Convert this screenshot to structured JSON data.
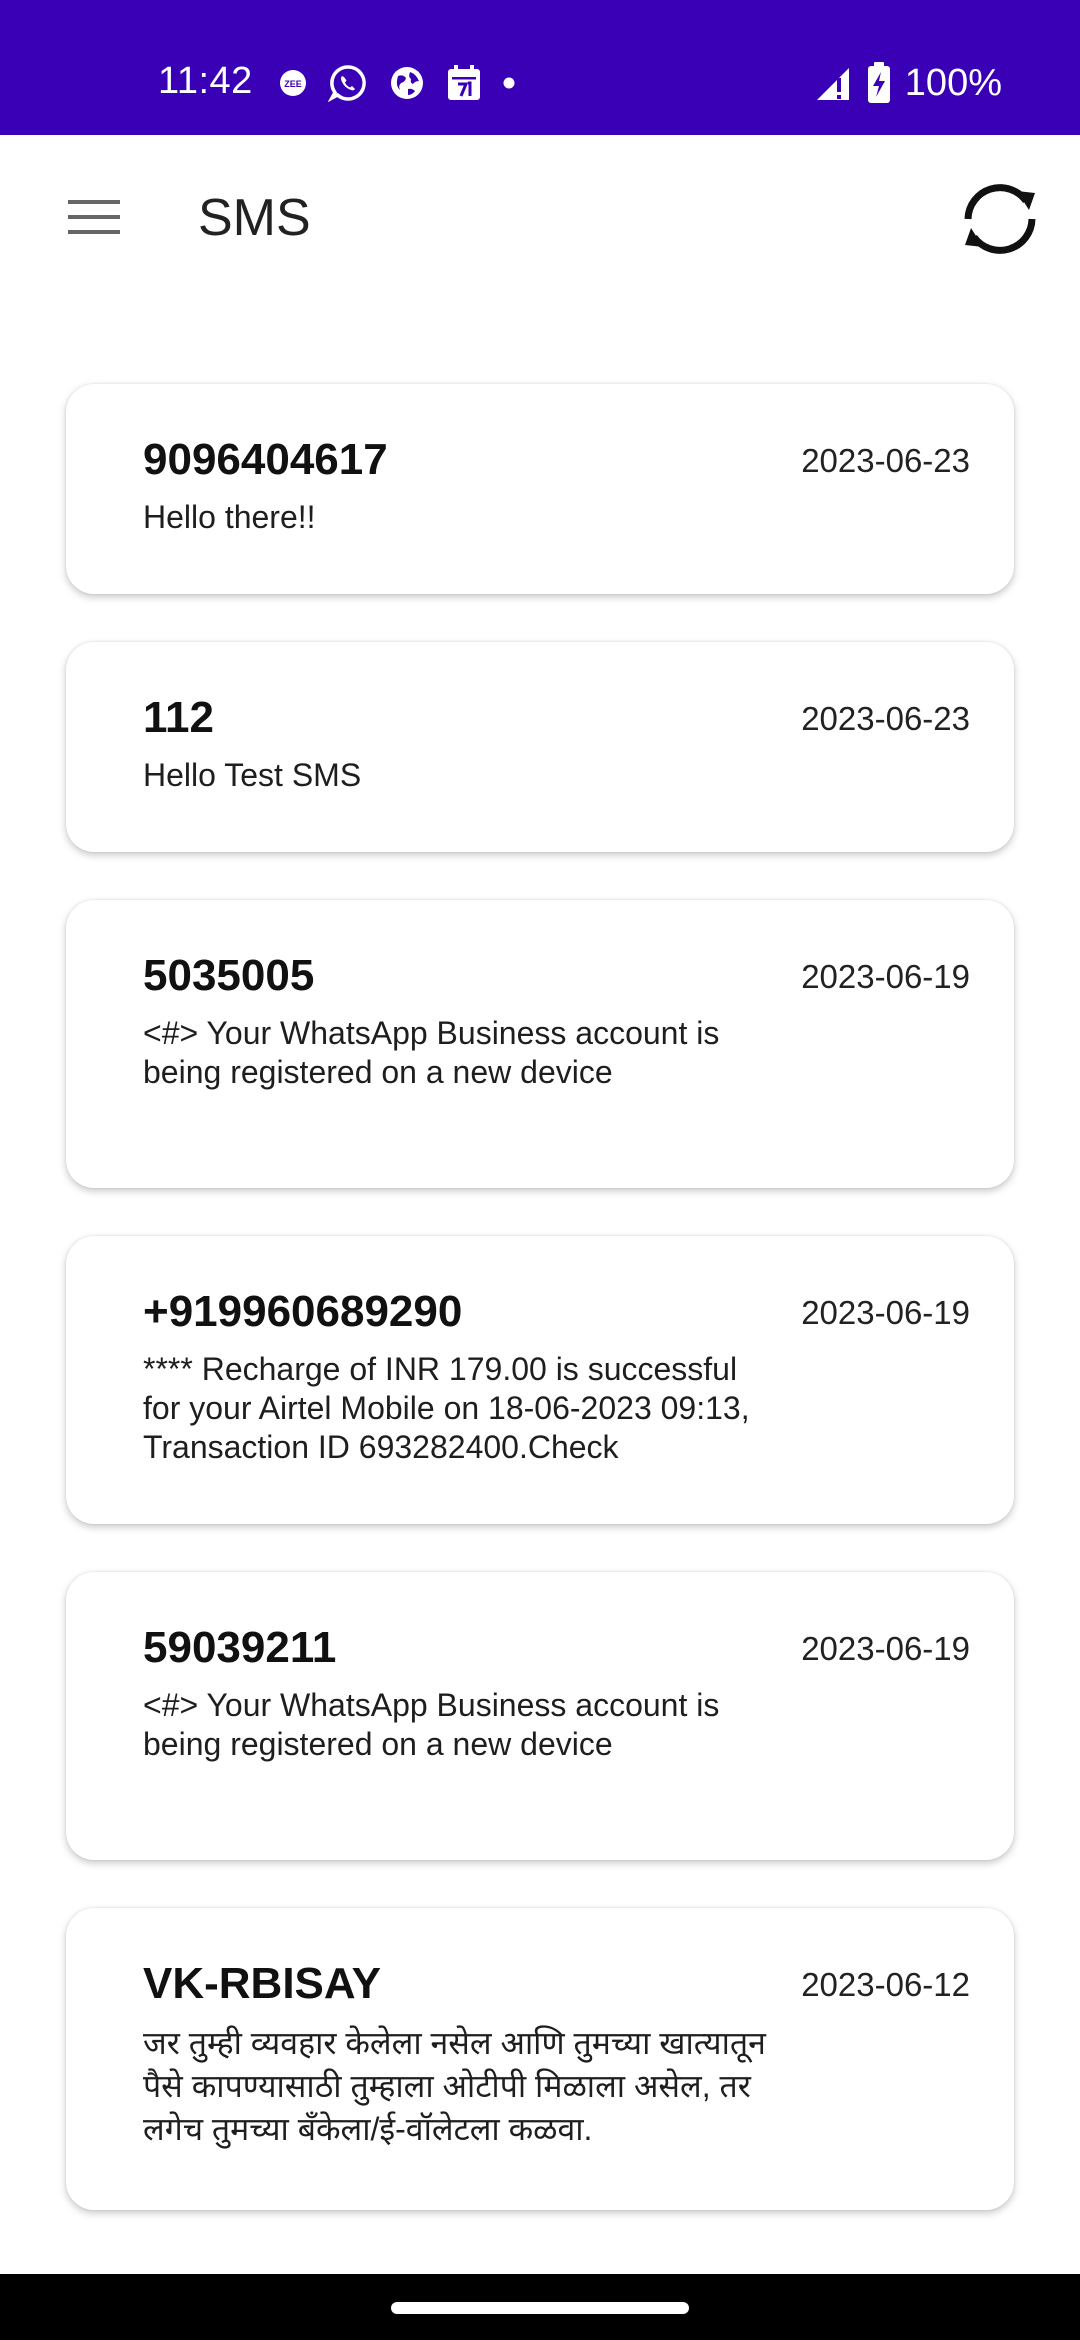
{
  "status_bar": {
    "time": "11:42",
    "battery": "100%",
    "background": "#3a00b5",
    "left_icons": [
      "zee5-icon",
      "whatsapp-icon",
      "globe-icon",
      "calendar-icon",
      "dot-icon"
    ],
    "right_icons": [
      "signal-icon",
      "battery-charging-icon"
    ]
  },
  "app_bar": {
    "title": "SMS",
    "menu_icon": "hamburger-menu-icon",
    "refresh_icon": "sync-icon"
  },
  "messages": [
    {
      "sender": "9096404617",
      "date": "2023-06-23",
      "body": "Hello there!!"
    },
    {
      "sender": "112",
      "date": "2023-06-23",
      "body": "Hello Test SMS"
    },
    {
      "sender": "5035005",
      "date": "2023-06-19",
      "body": "<#> Your WhatsApp Business account is being registered on a new device"
    },
    {
      "sender": "+919960689290",
      "date": "2023-06-19",
      "body": "**** Recharge of INR 179.00 is successful for your Airtel Mobile on 18-06-2023 09:13, Transaction ID 693282400.Check"
    },
    {
      "sender": "59039211",
      "date": "2023-06-19",
      "body": "<#> Your WhatsApp Business account is being registered on a new device"
    },
    {
      "sender": "VK-RBISAY",
      "date": "2023-06-12",
      "body": "जर तुम्ही व्यवहार केलेला नसेल आणि तुमच्या खात्यातून पैसे कापण्यासाठी तुम्हाला ओटीपी मिळाला असेल, तर लगेच तुमच्या बँकेला/ई-वॉलेटला कळवा."
    }
  ]
}
